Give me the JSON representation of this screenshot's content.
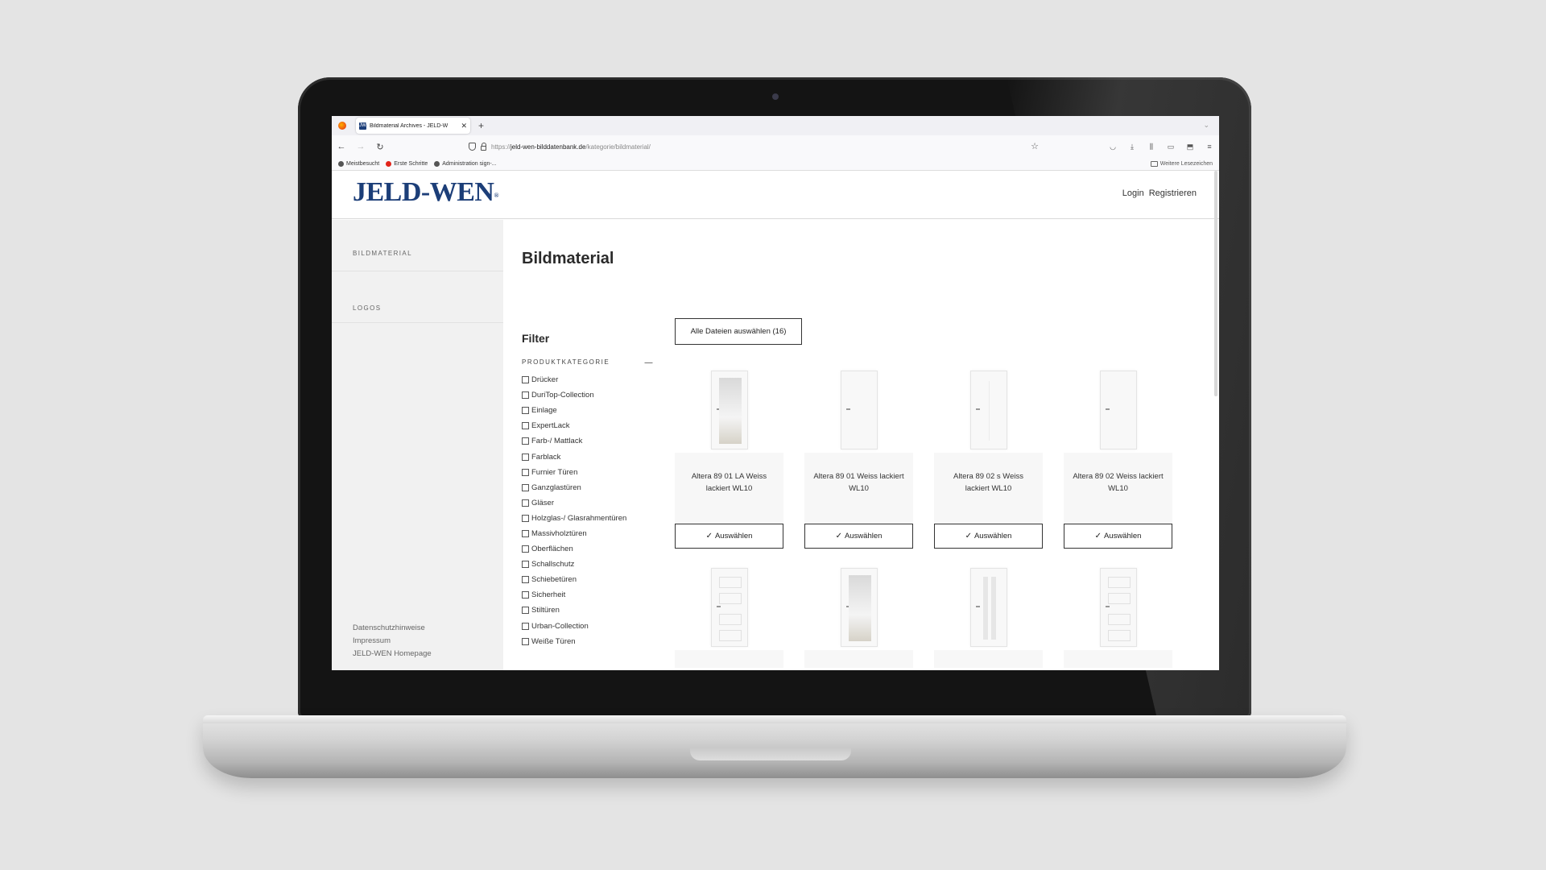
{
  "browser": {
    "tab_title": "Bildmaterial Archives - JELD-W",
    "tab_favicon": "JW",
    "url_prefix": "https://",
    "url_host": "jeld-wen-bilddatenbank.de",
    "url_path": "/kategorie/bildmaterial/",
    "bookmarks": [
      "Meistbesucht",
      "Erste Schritte",
      "Administration sign-..."
    ],
    "other_bookmarks": "Weitere Lesezeichen"
  },
  "site": {
    "brand": "JELD-WEN",
    "login": "Login",
    "register": "Registrieren"
  },
  "sidebar": {
    "items": [
      {
        "label": "BILDMATERIAL"
      },
      {
        "label": "LOGOS"
      }
    ],
    "footer": [
      "Datenschutzhinweise",
      "Impressum",
      "JELD-WEN Homepage"
    ]
  },
  "main": {
    "title": "Bildmaterial",
    "filter_title": "Filter",
    "filter_heading": "PRODUKTKATEGORIE",
    "filters": [
      "Drücker",
      "DuriTop-Collection",
      "Einlage",
      "ExpertLack",
      "Farb-/ Mattlack",
      "Farblack",
      "Furnier Türen",
      "Ganzglastüren",
      "Gläser",
      "Holzglas-/ Glasrahmentüren",
      "Massivholztüren",
      "Oberflächen",
      "Schallschutz",
      "Schiebetüren",
      "Sicherheit",
      "Stiltüren",
      "Urban-Collection",
      "Weiße Türen"
    ],
    "select_all": "Alle Dateien auswählen (16)",
    "select_label": "Auswählen",
    "cards": [
      {
        "caption": "Altera 89 01 LA Weiss lackiert WL10",
        "door": "glass"
      },
      {
        "caption": "Altera 89 01 Weiss lackiert WL10",
        "door": "plain"
      },
      {
        "caption": "Altera 89 02 s Weiss lackiert WL10",
        "door": "line"
      },
      {
        "caption": "Altera 89 02 Weiss lackiert WL10",
        "door": "plain"
      },
      {
        "caption": "",
        "door": "panels"
      },
      {
        "caption": "",
        "door": "glass"
      },
      {
        "caption": "",
        "door": "double-glass"
      },
      {
        "caption": "",
        "door": "panels"
      }
    ]
  }
}
